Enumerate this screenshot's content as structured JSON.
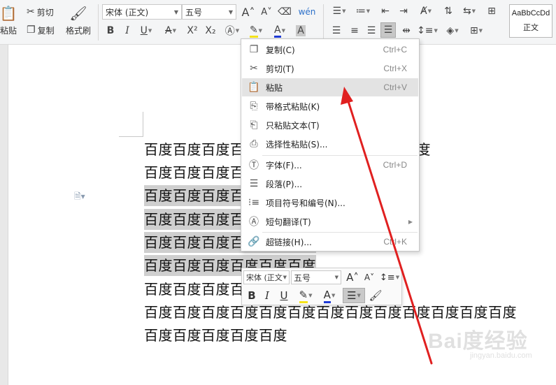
{
  "ribbon": {
    "paste_label": "粘贴",
    "cut_label": "剪切",
    "copy_label": "复制",
    "format_painter_label": "格式刷",
    "font_name": "宋体 (正文)",
    "font_size": "五号",
    "style_preview": "AaBbCcDd",
    "style_name": "正文"
  },
  "document": {
    "lines": [
      {
        "text": "百度百度百度百度百度百度百度百度百度百度",
        "selected": false
      },
      {
        "text": "百度百度百度百度百度百度",
        "selected": false
      },
      {
        "text": "百度百度百度百度百度百度",
        "selected": true
      },
      {
        "text": "百度百度百度百度百度百度",
        "selected": true
      },
      {
        "text": "百度百度百度百度百度百度",
        "selected": true
      },
      {
        "text": "百度百度百度百度百度百度",
        "selected": true
      },
      {
        "text": "百度百度百度百度百度百度百度百度百度",
        "selected": false
      },
      {
        "text": "百度百度百度百度百度百度百度百度百度百度百度百度百度",
        "selected": false
      },
      {
        "text": "百度百度百度百度百度",
        "selected": false
      }
    ]
  },
  "context_menu": {
    "items": [
      {
        "label": "复制(C)",
        "shortcut": "Ctrl+C",
        "icon": "copy-icon"
      },
      {
        "label": "剪切(T)",
        "shortcut": "Ctrl+X",
        "icon": "scissors-icon"
      },
      {
        "label": "粘贴",
        "shortcut": "Ctrl+V",
        "icon": "paste-icon"
      },
      {
        "label": "带格式粘贴(K)",
        "shortcut": "",
        "icon": "paste-format-icon"
      },
      {
        "label": "只粘贴文本(T)",
        "shortcut": "",
        "icon": "paste-text-icon"
      },
      {
        "label": "选择性粘贴(S)...",
        "shortcut": "",
        "icon": "paste-special-icon"
      },
      {
        "label": "字体(F)...",
        "shortcut": "Ctrl+D",
        "icon": "font-icon"
      },
      {
        "label": "段落(P)...",
        "shortcut": "",
        "icon": "paragraph-icon"
      },
      {
        "label": "项目符号和编号(N)...",
        "shortcut": "",
        "icon": "bullets-icon"
      },
      {
        "label": "短句翻译(T)",
        "shortcut": "",
        "icon": "translate-icon"
      },
      {
        "label": "超链接(H)...",
        "shortcut": "Ctrl+K",
        "icon": "link-icon"
      }
    ]
  },
  "mini_toolbar": {
    "font_name": "宋体 (正文)",
    "font_size": "五号"
  },
  "watermark": {
    "main": "Bai度经验",
    "sub": "jingyan.baidu.com"
  },
  "colors": {
    "highlight_yellow": "#f5e31a",
    "font_color_blue": "#1f3bd6",
    "arrow_red": "#e02020",
    "selection_gray": "#cfcfcf"
  }
}
